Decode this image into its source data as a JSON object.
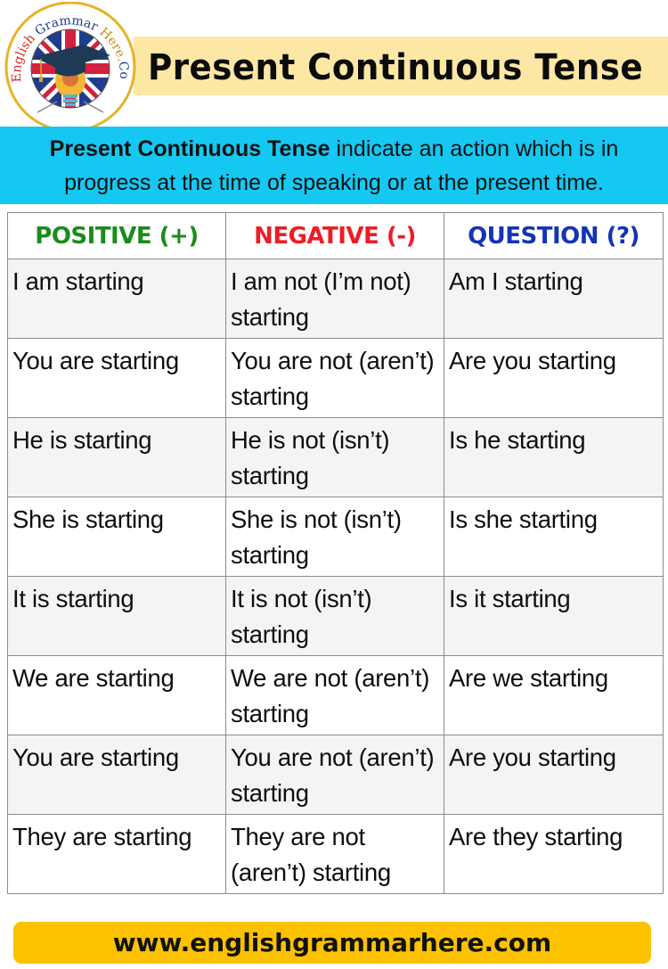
{
  "logo": {
    "text_red": "English ",
    "text_blue": "Grammar ",
    "text_orange": "Here.",
    "text_dark": "Com",
    "icon": "graduation-cap-lightbulb-uk-flag"
  },
  "title": "Present Continuous Tense",
  "definition": {
    "term": "Present Continuous Tense",
    "text": " indicate an action which is in progress at the time of speaking or at the present time."
  },
  "table": {
    "headers": {
      "positive": "POSITIVE (+)",
      "negative": "NEGATIVE (-)",
      "question": "QUESTION (?)"
    },
    "header_colors": {
      "positive": "#1a8c1a",
      "negative": "#ee1c24",
      "question": "#1434b4"
    },
    "rows": [
      {
        "positive": "I am starting",
        "negative": "I am not (I’m not) starting",
        "question": "Am I starting"
      },
      {
        "positive": "You are starting",
        "negative": "You are not (aren’t) starting",
        "question": "Are you starting"
      },
      {
        "positive": "He is starting",
        "negative": "He is not (isn’t) starting",
        "question": "Is he starting"
      },
      {
        "positive": "She is starting",
        "negative": "She is not (isn’t) starting",
        "question": "Is she starting"
      },
      {
        "positive": "It is starting",
        "negative": "It is not (isn’t) starting",
        "question": "Is it starting"
      },
      {
        "positive": "We are starting",
        "negative": "We are not (aren’t) starting",
        "question": "Are we starting"
      },
      {
        "positive": "You are starting",
        "negative": "You are not (aren’t) starting",
        "question": "Are you starting"
      },
      {
        "positive": "They are starting",
        "negative": "They are not (aren’t) starting",
        "question": "Are they starting"
      }
    ]
  },
  "footer": {
    "url": "www.englishgrammarhere.com"
  },
  "colors": {
    "title_band": "#fde7a4",
    "definition_band": "#14c8f2",
    "footer_band": "#fcc200"
  }
}
